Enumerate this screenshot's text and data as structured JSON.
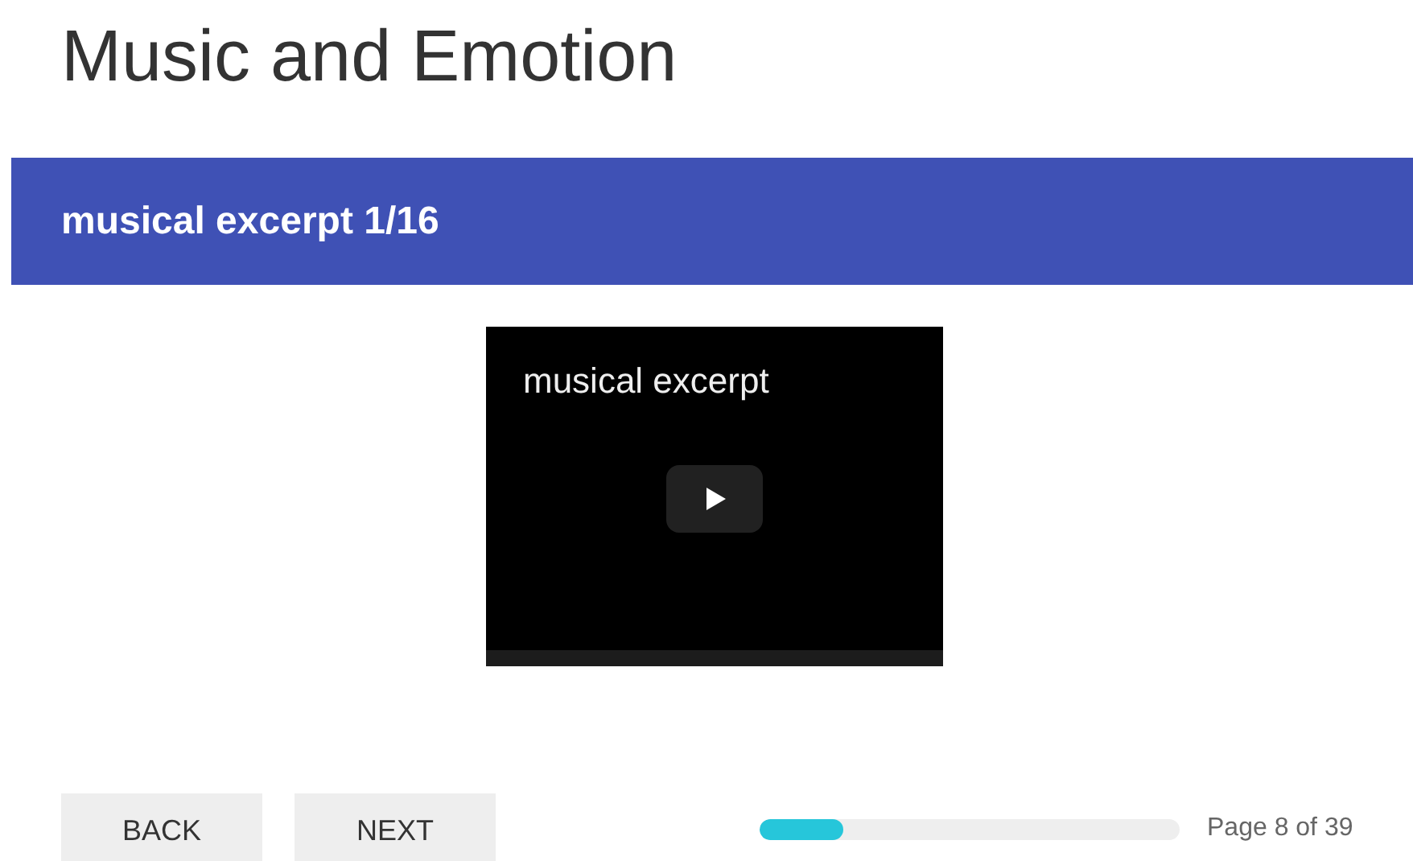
{
  "title": "Music and Emotion",
  "section": {
    "heading": "musical excerpt 1/16"
  },
  "video": {
    "title": "musical excerpt"
  },
  "buttons": [
    {
      "label": "BACK"
    },
    {
      "label": "NEXT"
    }
  ],
  "progress": {
    "level": 0.2,
    "label": "Page 8 of 39"
  }
}
